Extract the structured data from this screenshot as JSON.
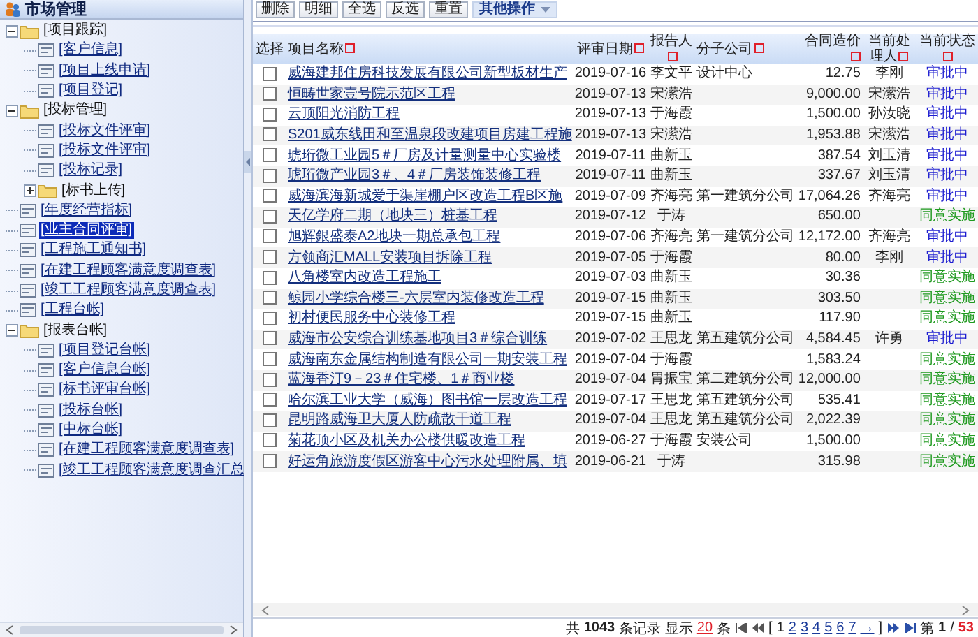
{
  "sidebar": {
    "title": "市场管理",
    "tree": [
      {
        "label": "[项目跟踪]",
        "kind": "folder",
        "expanded": true,
        "selected": false,
        "children": [
          {
            "label": "[客户信息]",
            "kind": "page",
            "selected": false
          },
          {
            "label": "[项目上线申请]",
            "kind": "page",
            "selected": false
          },
          {
            "label": "[项目登记]",
            "kind": "page",
            "selected": false
          }
        ]
      },
      {
        "label": "[投标管理]",
        "kind": "folder",
        "expanded": true,
        "selected": false,
        "children": [
          {
            "label": "[投标文件评审]",
            "kind": "page",
            "selected": false
          },
          {
            "label": "[投标文件评审]",
            "kind": "page",
            "selected": false
          },
          {
            "label": "[投标记录]",
            "kind": "page",
            "selected": false
          },
          {
            "label": "[标书上传]",
            "kind": "folder",
            "expanded": false,
            "selected": false
          }
        ]
      },
      {
        "label": "[年度经营指标]",
        "kind": "page",
        "selected": false
      },
      {
        "label": "[业主合同评审]",
        "kind": "page",
        "selected": true
      },
      {
        "label": "[工程施工通知书]",
        "kind": "page",
        "selected": false
      },
      {
        "label": "[在建工程顾客满意度调查表]",
        "kind": "page",
        "selected": false
      },
      {
        "label": "[竣工工程顾客满意度调查表]",
        "kind": "page",
        "selected": false
      },
      {
        "label": "[工程台帐]",
        "kind": "page",
        "selected": false
      },
      {
        "label": "[报表台帐]",
        "kind": "folder",
        "expanded": true,
        "selected": false,
        "children": [
          {
            "label": "[项目登记台帐]",
            "kind": "page",
            "selected": false
          },
          {
            "label": "[客户信息台帐]",
            "kind": "page",
            "selected": false
          },
          {
            "label": "[标书评审台帐]",
            "kind": "page",
            "selected": false
          },
          {
            "label": "[投标台帐]",
            "kind": "page",
            "selected": false
          },
          {
            "label": "[中标台帐]",
            "kind": "page",
            "selected": false
          },
          {
            "label": "[在建工程顾客满意度调查表]",
            "kind": "page",
            "selected": false
          },
          {
            "label": "[竣工工程顾客满意度调查汇总",
            "kind": "page",
            "selected": false
          }
        ]
      }
    ]
  },
  "toolbar": {
    "buttons": [
      "删除",
      "明细",
      "全选",
      "反选",
      "重置"
    ],
    "menu": "其他操作"
  },
  "table": {
    "columns": [
      {
        "label": "选择",
        "sortable": false
      },
      {
        "label": "项目名称",
        "sortable": true
      },
      {
        "label": "评审日期",
        "sortable": true
      },
      {
        "label": "报告人",
        "sortable": true
      },
      {
        "label": "分子公司",
        "sortable": true
      },
      {
        "label": "合同造价",
        "sortable": true
      },
      {
        "label": "当前处理人",
        "sortable": true
      },
      {
        "label": "当前状态",
        "sortable": true
      }
    ],
    "rows": [
      {
        "checked": false,
        "name": "威海建邦住房科技发展有限公司新型板材生产",
        "date": "2019-07-16",
        "reporter": "李文平",
        "company": "设计中心",
        "price": "12.75",
        "handler": "李刚",
        "status": {
          "text": "审批中",
          "color": "#1c1cd0"
        }
      },
      {
        "checked": false,
        "name": "恒畴世家壹号院示范区工程",
        "date": "2019-07-13",
        "reporter": "宋潆浩",
        "price": "9,000.00",
        "handler": "宋潆浩",
        "status": {
          "text": "审批中",
          "color": "#1c1cd0"
        }
      },
      {
        "checked": false,
        "name": "云顶阳光消防工程",
        "date": "2019-07-13",
        "reporter": "于海霞",
        "price": "1,500.00",
        "handler": "孙汝晓",
        "status": {
          "text": "审批中",
          "color": "#1c1cd0"
        }
      },
      {
        "checked": false,
        "name": "S201威东线田和至温泉段改建项目房建工程施",
        "date": "2019-07-13",
        "reporter": "宋潆浩",
        "price": "1,953.88",
        "handler": "宋潆浩",
        "status": {
          "text": "审批中",
          "color": "#1c1cd0"
        }
      },
      {
        "checked": false,
        "name": "琥珩微工业园5＃厂房及计量测量中心实验楼",
        "date": "2019-07-11",
        "reporter": "曲新玉",
        "price": "387.54",
        "handler": "刘玉清",
        "status": {
          "text": "审批中",
          "color": "#1c1cd0"
        }
      },
      {
        "checked": false,
        "name": "琥珩微产业园3＃、4＃厂房装饰装修工程",
        "date": "2019-07-11",
        "reporter": "曲新玉",
        "price": "337.67",
        "handler": "刘玉清",
        "status": {
          "text": "审批中",
          "color": "#1c1cd0"
        }
      },
      {
        "checked": false,
        "name": "威海滨海新城爱于渠崖棚户区改造工程B区施",
        "date": "2019-07-09",
        "reporter": "齐海亮",
        "company": "第一建筑分公司",
        "price": "17,064.26",
        "handler": "齐海亮",
        "status": {
          "text": "审批中",
          "color": "#1c1cd0"
        }
      },
      {
        "checked": false,
        "name": "天亿学府二期（地块三）桩基工程",
        "date": "2019-07-12",
        "reporter": "于涛",
        "price": "650.00",
        "status": {
          "text": "同意实施",
          "color": "#1f9a1f"
        }
      },
      {
        "checked": false,
        "name": "旭辉銀盛泰A2地块一期总承包工程",
        "date": "2019-07-06",
        "reporter": "齐海亮",
        "company": "第一建筑分公司",
        "price": "12,172.00",
        "handler": "齐海亮",
        "status": {
          "text": "审批中",
          "color": "#1c1cd0"
        }
      },
      {
        "checked": false,
        "name": "方领商汇MALL安装项目拆除工程",
        "date": "2019-07-05",
        "reporter": "于海霞",
        "price": "80.00",
        "handler": "李刚",
        "status": {
          "text": "审批中",
          "color": "#1c1cd0"
        }
      },
      {
        "checked": false,
        "name": "八角楼室内改造工程施工",
        "date": "2019-07-03",
        "reporter": "曲新玉",
        "price": "30.36",
        "status": {
          "text": "同意实施",
          "color": "#1f9a1f"
        }
      },
      {
        "checked": false,
        "name": "鲸园小学综合楼三-六层室内装修改造工程",
        "date": "2019-07-15",
        "reporter": "曲新玉",
        "price": "303.50",
        "status": {
          "text": "同意实施",
          "color": "#1f9a1f"
        }
      },
      {
        "checked": false,
        "name": "初村便民服务中心装修工程",
        "date": "2019-07-15",
        "reporter": "曲新玉",
        "price": "117.90",
        "status": {
          "text": "同意实施",
          "color": "#1f9a1f"
        }
      },
      {
        "checked": false,
        "name": "威海市公安综合训练基地项目3＃综合训练",
        "date": "2019-07-02",
        "reporter": "王思龙",
        "company": "第五建筑分公司",
        "price": "4,584.45",
        "handler": "许勇",
        "status": {
          "text": "审批中",
          "color": "#1c1cd0"
        }
      },
      {
        "checked": false,
        "name": "威海南东金属结构制造有限公司一期安装工程",
        "date": "2019-07-04",
        "reporter": "于海霞",
        "price": "1,583.24",
        "status": {
          "text": "同意实施",
          "color": "#1f9a1f"
        }
      },
      {
        "checked": false,
        "name": "蓝海香汀9－23＃住宅楼、1＃商业楼",
        "date": "2019-07-04",
        "reporter": "胃振宝",
        "company": "第二建筑分公司",
        "price": "12,000.00",
        "status": {
          "text": "同意实施",
          "color": "#1f9a1f"
        }
      },
      {
        "checked": false,
        "name": "哈尔滨工业大学（威海）图书馆一层改造工程",
        "date": "2019-07-17",
        "reporter": "王思龙",
        "company": "第五建筑分公司",
        "price": "535.41",
        "status": {
          "text": "同意实施",
          "color": "#1f9a1f"
        }
      },
      {
        "checked": false,
        "name": "昆明路威海卫大厦人防疏散干道工程",
        "date": "2019-07-04",
        "reporter": "王思龙",
        "company": "第五建筑分公司",
        "price": "2,022.39",
        "status": {
          "text": "同意实施",
          "color": "#1f9a1f"
        }
      },
      {
        "checked": false,
        "name": "菊花顶小区及机关办公楼供暖改造工程",
        "date": "2019-06-27",
        "reporter": "于海霞",
        "company": "安装公司",
        "price": "1,500.00",
        "status": {
          "text": "同意实施",
          "color": "#1f9a1f"
        }
      },
      {
        "checked": false,
        "name": "好运角旅游度假区游客中心污水处理附属、填",
        "date": "2019-06-21",
        "reporter": "于涛",
        "price": "315.98",
        "status": {
          "text": "同意实施",
          "color": "#1f9a1f"
        }
      }
    ]
  },
  "pagination": {
    "prefix": "共",
    "total": "1043",
    "records_label": "条记录 显示",
    "page_size": "20",
    "size_suffix": "条",
    "open_bracket": "[",
    "pages": [
      {
        "label": "1",
        "selected": true
      },
      {
        "label": "2",
        "selected": false
      },
      {
        "label": "3",
        "selected": false
      },
      {
        "label": "4",
        "selected": false
      },
      {
        "label": "5",
        "selected": false
      },
      {
        "label": "6",
        "selected": false
      },
      {
        "label": "7",
        "selected": false
      }
    ],
    "next_group": "→",
    "close_bracket": "]",
    "page_label": "第",
    "current": "1",
    "separator": "/",
    "page_count": "53"
  }
}
